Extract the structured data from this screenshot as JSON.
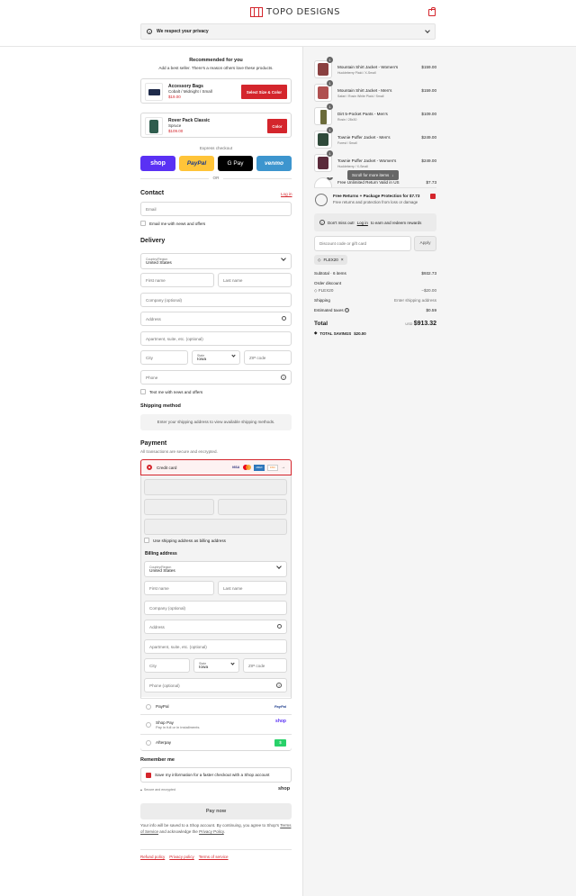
{
  "brand": {
    "name": "TOPO DESIGNS",
    "accent": "#d4252c"
  },
  "privacy": {
    "label": "We respect your privacy"
  },
  "recommend": {
    "title": "Recommended for you",
    "subtitle": "Add a best seller. There's a reason others love these products.",
    "items": [
      {
        "name": "Accessory Bags",
        "variant": "Cobalt / Midnight / Small",
        "price": "$19.00",
        "button": "Select Size & Color"
      },
      {
        "name": "Rover Pack Classic",
        "variant": "Spruce",
        "price": "$109.00",
        "button": "Color"
      }
    ]
  },
  "express": {
    "label": "Express checkout",
    "or": "OR",
    "buttons": [
      "shop",
      "PayPal",
      "G Pay",
      "venmo"
    ]
  },
  "contact": {
    "title": "Contact",
    "login": "Log in",
    "email_placeholder": "Email",
    "news_label": "Email me with news and offers"
  },
  "delivery": {
    "title": "Delivery",
    "country_label": "Country/Region",
    "country_value": "United States",
    "first_name": "First name",
    "last_name": "Last name",
    "company": "Company (optional)",
    "address": "Address",
    "apartment": "Apartment, suite, etc. (optional)",
    "city": "City",
    "state_label": "State",
    "state_value": "Iowa",
    "zip": "ZIP code",
    "phone": "Phone",
    "text_label": "Text me with news and offers"
  },
  "shipping": {
    "title": "Shipping method",
    "message": "Enter your shipping address to view available shipping methods."
  },
  "payment": {
    "title": "Payment",
    "subtitle": "All transactions are secure and encrypted.",
    "credit_card": "Credit card",
    "card_brands": [
      "VISA",
      "MC",
      "AMEX",
      "DISC"
    ],
    "use_shipping": "Use shipping address as billing address",
    "billing_title": "Billing address",
    "billing": {
      "country_label": "Country/Region",
      "country_value": "United States",
      "first_name": "First name",
      "last_name": "Last name",
      "company": "Company (optional)",
      "address": "Address",
      "apartment": "Apartment, suite, etc. (optional)",
      "city": "City",
      "state_label": "State",
      "state_value": "Iowa",
      "zip": "ZIP code",
      "phone": "Phone (optional)"
    },
    "methods": [
      {
        "name": "PayPal",
        "logo": "PayPal"
      },
      {
        "name": "Shop Pay",
        "sub": "Pay in full or in installments",
        "logo": "shop"
      },
      {
        "name": "Afterpay",
        "logo": "$"
      }
    ]
  },
  "remember": {
    "title": "Remember me",
    "save_label": "Save my information for a faster checkout with a Shop account",
    "secure": "Secure and encrypted",
    "shop": "shop"
  },
  "pay_now": "Pay now",
  "legal": {
    "text": "Your info will be saved to a Shop account. By continuing, you agree to Shop's",
    "terms": "Terms of Service",
    "and": "and acknowledge the",
    "privacy": "Privacy Policy",
    "end": "."
  },
  "footer": {
    "refund": "Refund policy",
    "privacy": "Privacy policy",
    "terms": "Terms of service"
  },
  "cart": {
    "items": [
      {
        "qty": "1",
        "name": "Mountain Shirt Jacket - Women's",
        "variant": "Huckleberry Plaid / X-Small",
        "price": "$159.00"
      },
      {
        "qty": "1",
        "name": "Mountain Shirt Jacket - Men's",
        "variant": "Safari / Rosin White Plaid / Small",
        "price": "$159.00"
      },
      {
        "qty": "1",
        "name": "Dirt 5-Pocket Pants - Men's",
        "variant": "Rosin / 28x30",
        "price": "$109.00"
      },
      {
        "qty": "1",
        "name": "Townie Puffer Jacket - Men's",
        "variant": "Forest / Small",
        "price": "$249.00"
      },
      {
        "qty": "1",
        "name": "Townie Puffer Jacket - Women's",
        "variant": "Huckleberry / X-Small",
        "price": "$249.00"
      },
      {
        "qty": "1",
        "name": "Free Unlimited Return Valid in US",
        "variant": "",
        "price": "$7.73"
      }
    ],
    "scroll_hint": "Scroll for more items",
    "protection": {
      "title": "Free Returns + Package Protection for $7.73",
      "sub": "Free returns and protection from loss or damage"
    },
    "rewards": {
      "pre": "Don't miss out!",
      "link": "Log in",
      "post": "to earn and redeem rewards"
    },
    "discount_placeholder": "Discount code or gift card",
    "apply": "Apply",
    "code_chip": "FLEX20",
    "subtotal_label": "Subtotal · 6 items",
    "subtotal": "$932.73",
    "order_discount": "Order discount",
    "code": "FLEX20",
    "discount_value": "−$20.00",
    "shipping_label": "Shipping",
    "shipping_value": "Enter shipping address",
    "taxes_label": "Estimated taxes",
    "taxes_value": "$0.59",
    "total_label": "Total",
    "currency": "USD",
    "total": "$913.32",
    "savings_label": "TOTAL SAVINGS",
    "savings": "$20.00"
  }
}
